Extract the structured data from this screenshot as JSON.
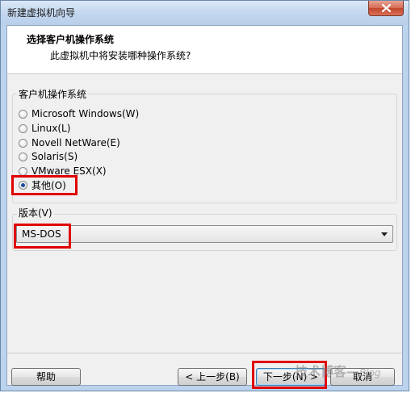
{
  "window": {
    "title": "新建虚拟机向导"
  },
  "header": {
    "title": "选择客户机操作系统",
    "subtitle": "此虚拟机中将安装哪种操作系统?"
  },
  "guest_os_group": {
    "label": "客户机操作系统",
    "options": [
      {
        "label": "Microsoft Windows(W)",
        "selected": false
      },
      {
        "label": "Linux(L)",
        "selected": false
      },
      {
        "label": "Novell NetWare(E)",
        "selected": false
      },
      {
        "label": "Solaris(S)",
        "selected": false
      },
      {
        "label": "VMware ESX(X)",
        "selected": false
      },
      {
        "label": "其他(O)",
        "selected": true
      }
    ]
  },
  "version_group": {
    "label": "版本(V)",
    "selected_value": "MS-DOS"
  },
  "buttons": {
    "help": "帮助",
    "back": "< 上一步(B)",
    "next": "下一步(N) >",
    "cancel": "取消"
  },
  "watermark": {
    "text": "技术博客",
    "suffix": "Blog"
  },
  "colors": {
    "highlight": "#e00000",
    "radio_selected": "#1d4d9c",
    "close_button": "#c2452a"
  }
}
